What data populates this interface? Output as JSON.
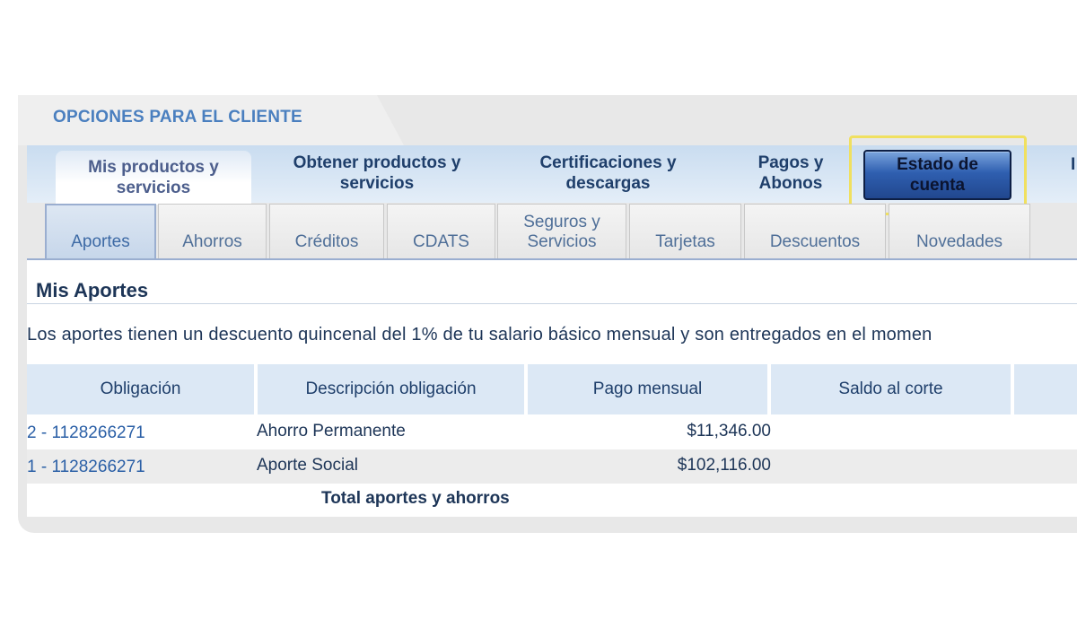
{
  "header": {
    "title": "OPCIONES PARA EL CLIENTE"
  },
  "topnav": {
    "items": [
      {
        "label_line1": "Mis productos y",
        "label_line2": "servicios"
      },
      {
        "label_line1": "Obtener productos y",
        "label_line2": "servicios"
      },
      {
        "label_line1": "Certificaciones y",
        "label_line2": "descargas"
      },
      {
        "label_line1": "Pagos y",
        "label_line2": "Abonos"
      },
      {
        "label_line1": "Estado de",
        "label_line2": "cuenta"
      }
    ],
    "edge_letter": "I"
  },
  "subtabs": [
    {
      "label": "Aportes"
    },
    {
      "label": "Ahorros"
    },
    {
      "label": "Créditos"
    },
    {
      "label": "CDATS"
    },
    {
      "label_line1": "Seguros y",
      "label_line2": "Servicios"
    },
    {
      "label": "Tarjetas"
    },
    {
      "label": "Descuentos"
    },
    {
      "label": "Novedades"
    }
  ],
  "main": {
    "title": "Mis Aportes",
    "description": "Los aportes tienen un descuento quincenal del 1% de tu salario básico mensual y son entregados en el momen"
  },
  "table": {
    "headers": [
      "Obligación",
      "Descripción obligación",
      "Pago mensual",
      "Saldo al corte"
    ],
    "rows": [
      {
        "obligacion": "2 - 1128266271",
        "descripcion": "Ahorro Permanente",
        "pago": "$11,346.00"
      },
      {
        "obligacion": "1 - 1128266271",
        "descripcion": "Aporte Social",
        "pago": "$102,116.00"
      }
    ],
    "total_label": "Total aportes y ahorros"
  },
  "colors": {
    "accent": "#4a7fbf",
    "highlight": "#f0e060",
    "active_button": "#2f5fb0"
  }
}
